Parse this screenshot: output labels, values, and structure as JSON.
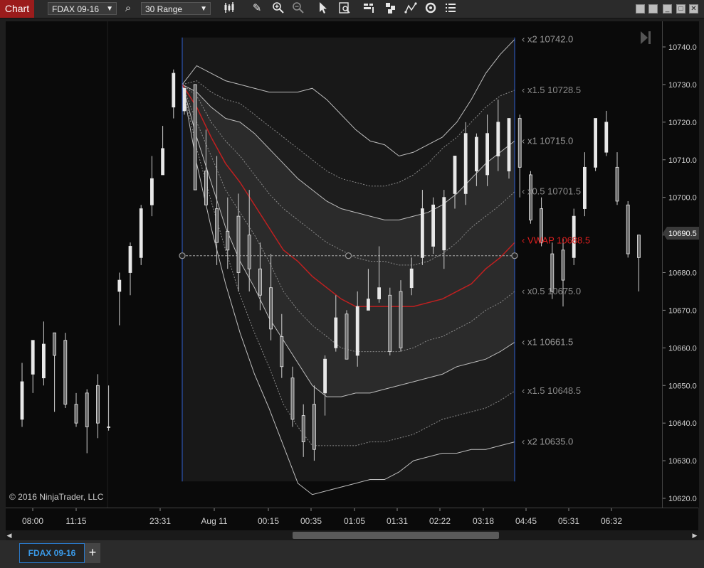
{
  "toolbar": {
    "title": "Chart",
    "instrument": "FDAX 09-16",
    "interval": "30 Range",
    "icons": [
      "search-icon",
      "bar-type-icon",
      "pencil-icon",
      "zoom-in-icon",
      "zoom-out-icon",
      "pointer-icon",
      "data-box-icon",
      "strategies-icon",
      "indicators-icon",
      "properties-icon",
      "reload-icon",
      "list-icon"
    ],
    "window_buttons": [
      "tile-icon",
      "tile-icon",
      "minimize-icon",
      "maximize-icon",
      "close-icon"
    ]
  },
  "chart": {
    "copyright": "© 2016 NinjaTrader, LLC",
    "last_price": "10690.5",
    "y_ticks": [
      "10740.0",
      "10730.0",
      "10720.0",
      "10710.0",
      "10700.0",
      "10690.0",
      "10680.0",
      "10670.0",
      "10660.0",
      "10650.0",
      "10640.0",
      "10630.0",
      "10620.0"
    ],
    "x_ticks": [
      "08:00",
      "11:15",
      "23:31",
      "Aug 11",
      "00:15",
      "00:35",
      "01:05",
      "01:31",
      "02:22",
      "03:18",
      "04:45",
      "05:31",
      "06:32"
    ],
    "vwap_labels": [
      {
        "text": "x2 10742.0",
        "color": "#9a9a9a"
      },
      {
        "text": "x1.5 10728.5",
        "color": "#8a8a8a"
      },
      {
        "text": "x1 10715.0",
        "color": "#9a9a9a"
      },
      {
        "text": "x0.5 10701.5",
        "color": "#8a8a8a"
      },
      {
        "text": "VWAP 10688.5",
        "color": "#e01e1e"
      },
      {
        "text": "x0.5 10675.0",
        "color": "#8a8a8a"
      },
      {
        "text": "x1 10661.5",
        "color": "#9a9a9a"
      },
      {
        "text": "x1.5 10648.5",
        "color": "#8a8a8a"
      },
      {
        "text": "x2 10635.0",
        "color": "#9a9a9a"
      }
    ]
  },
  "chart_data": {
    "type": "candlestick",
    "ylim": [
      10616,
      10748
    ],
    "candles": [
      {
        "o": 10641,
        "c": 10651,
        "h": 10656,
        "l": 10639
      },
      {
        "o": 10653,
        "c": 10662,
        "h": 10662,
        "l": 10648
      },
      {
        "o": 10652,
        "c": 10661,
        "h": 10667,
        "l": 10650
      },
      {
        "o": 10664,
        "c": 10658,
        "h": 10664,
        "l": 10643
      },
      {
        "o": 10662,
        "c": 10645,
        "h": 10664,
        "l": 10644
      },
      {
        "o": 10645,
        "c": 10640,
        "h": 10648,
        "l": 10639
      },
      {
        "o": 10648,
        "c": 10639,
        "h": 10649,
        "l": 10632
      },
      {
        "o": 10650,
        "c": 10640,
        "h": 10653,
        "l": 10636
      },
      {
        "o": 10639,
        "c": 10639,
        "h": 10650,
        "l": 10638
      },
      {
        "o": 10675,
        "c": 10678,
        "h": 10680,
        "l": 10666
      },
      {
        "o": 10680,
        "c": 10687,
        "h": 10688,
        "l": 10674
      },
      {
        "o": 10684,
        "c": 10697,
        "h": 10698,
        "l": 10682
      },
      {
        "o": 10698,
        "c": 10705,
        "h": 10711,
        "l": 10695
      },
      {
        "o": 10706,
        "c": 10713,
        "h": 10719,
        "l": 10706
      },
      {
        "o": 10724,
        "c": 10733,
        "h": 10734,
        "l": 10721
      },
      {
        "o": 10723,
        "c": 10729,
        "h": 10729,
        "l": 10722
      },
      {
        "o": 10730,
        "c": 10702,
        "h": 10730,
        "l": 10703
      },
      {
        "o": 10707,
        "c": 10698,
        "h": 10718,
        "l": 10698
      },
      {
        "o": 10697,
        "c": 10688,
        "h": 10711,
        "l": 10682
      },
      {
        "o": 10691,
        "c": 10686,
        "h": 10700,
        "l": 10681
      },
      {
        "o": 10695,
        "c": 10680,
        "h": 10701,
        "l": 10675
      },
      {
        "o": 10690,
        "c": 10681,
        "h": 10702,
        "l": 10675
      },
      {
        "o": 10681,
        "c": 10674,
        "h": 10688,
        "l": 10670
      },
      {
        "o": 10676,
        "c": 10665,
        "h": 10685,
        "l": 10662
      },
      {
        "o": 10663,
        "c": 10655,
        "h": 10669,
        "l": 10652
      },
      {
        "o": 10652,
        "c": 10641,
        "h": 10655,
        "l": 10639
      },
      {
        "o": 10642,
        "c": 10635,
        "h": 10645,
        "l": 10631
      },
      {
        "o": 10645,
        "c": 10633,
        "h": 10650,
        "l": 10630
      },
      {
        "o": 10648,
        "c": 10657,
        "h": 10658,
        "l": 10642
      },
      {
        "o": 10660,
        "c": 10668,
        "h": 10674,
        "l": 10659
      },
      {
        "o": 10669,
        "c": 10657,
        "h": 10670,
        "l": 10657
      },
      {
        "o": 10658,
        "c": 10671,
        "h": 10675,
        "l": 10655
      },
      {
        "o": 10670,
        "c": 10673,
        "h": 10681,
        "l": 10670
      },
      {
        "o": 10673,
        "c": 10676,
        "h": 10687,
        "l": 10672
      },
      {
        "o": 10674,
        "c": 10659,
        "h": 10676,
        "l": 10658
      },
      {
        "o": 10675,
        "c": 10660,
        "h": 10678,
        "l": 10659
      },
      {
        "o": 10676,
        "c": 10681,
        "h": 10684,
        "l": 10674
      },
      {
        "o": 10684,
        "c": 10697,
        "h": 10702,
        "l": 10682
      },
      {
        "o": 10687,
        "c": 10698,
        "h": 10700,
        "l": 10685
      },
      {
        "o": 10686,
        "c": 10700,
        "h": 10702,
        "l": 10681
      },
      {
        "o": 10701,
        "c": 10711,
        "h": 10711,
        "l": 10697
      },
      {
        "o": 10701,
        "c": 10717,
        "h": 10720,
        "l": 10698
      },
      {
        "o": 10707,
        "c": 10716,
        "h": 10717,
        "l": 10703
      },
      {
        "o": 10706,
        "c": 10717,
        "h": 10722,
        "l": 10703
      },
      {
        "o": 10711,
        "c": 10720,
        "h": 10726,
        "l": 10707
      },
      {
        "o": 10707,
        "c": 10721,
        "h": 10721,
        "l": 10705
      },
      {
        "o": 10721,
        "c": 10708,
        "h": 10722,
        "l": 10700
      },
      {
        "o": 10706,
        "c": 10694,
        "h": 10707,
        "l": 10693
      },
      {
        "o": 10697,
        "c": 10688,
        "h": 10700,
        "l": 10687
      },
      {
        "o": 10685,
        "c": 10675,
        "h": 10688,
        "l": 10673
      },
      {
        "o": 10686,
        "c": 10678,
        "h": 10689,
        "l": 10671
      },
      {
        "o": 10684,
        "c": 10695,
        "h": 10697,
        "l": 10682
      },
      {
        "o": 10697,
        "c": 10708,
        "h": 10712,
        "l": 10695
      },
      {
        "o": 10708,
        "c": 10721,
        "h": 10721,
        "l": 10707
      },
      {
        "o": 10712,
        "c": 10720,
        "h": 10723,
        "l": 10711
      },
      {
        "o": 10708,
        "c": 10699,
        "h": 10712,
        "l": 10698
      },
      {
        "o": 10698,
        "c": 10685,
        "h": 10699,
        "l": 10684
      },
      {
        "o": 10690,
        "c": 10684,
        "h": 10690,
        "l": 10675
      }
    ],
    "vwap": [
      10730,
      10724,
      10716,
      10709,
      10704,
      10698,
      10692,
      10686,
      10683,
      10679,
      10676,
      10673,
      10671,
      10671,
      10671,
      10671,
      10671,
      10672,
      10673,
      10675,
      10677,
      10681,
      10684,
      10688
    ],
    "bands": [
      {
        "mult": 0.5,
        "upper": [
          10730,
          10727,
          10720,
          10715,
          10711,
          10706,
          10701,
          10697,
          10694,
          10691,
          10688,
          10686,
          10684,
          10683,
          10683,
          10682,
          10682,
          10683,
          10685,
          10688,
          10692,
          10695,
          10698,
          10701.5
        ],
        "lower": [
          10730,
          10720,
          10711,
          10702,
          10696,
          10690,
          10683,
          10675,
          10670,
          10666,
          10663,
          10660,
          10659,
          10659,
          10659,
          10659,
          10660,
          10662,
          10663,
          10665,
          10667,
          10670,
          10672,
          10675
        ]
      },
      {
        "mult": 1,
        "upper": [
          10730,
          10728,
          10724,
          10721,
          10720,
          10717,
          10713,
          10709,
          10705,
          10702,
          10699,
          10697,
          10696,
          10695,
          10694,
          10694,
          10695,
          10696,
          10698,
          10701,
          10705,
          10709,
          10712,
          10715
        ],
        "lower": [
          10730,
          10716,
          10704,
          10692,
          10683,
          10676,
          10668,
          10662,
          10656,
          10650,
          10647,
          10647,
          10648,
          10648,
          10649,
          10650,
          10651,
          10652,
          10653,
          10655,
          10656,
          10657,
          10659,
          10661.5
        ]
      },
      {
        "mult": 1.5,
        "upper": [
          10730,
          10731,
          10728,
          10726,
          10725,
          10722,
          10719,
          10716,
          10713,
          10710,
          10707,
          10705,
          10704,
          10703,
          10703,
          10704,
          10706,
          10709,
          10713,
          10716,
          10720,
          10724,
          10727,
          10728.5
        ],
        "lower": [
          10730,
          10713,
          10699,
          10686,
          10674,
          10664,
          10655,
          10645,
          10639,
          10634,
          10634,
          10634,
          10634,
          10635,
          10635,
          10636,
          10637,
          10639,
          10641,
          10642,
          10643,
          10644,
          10646,
          10648.5
        ]
      },
      {
        "mult": 2,
        "upper": [
          10730,
          10735,
          10733,
          10731,
          10730,
          10729,
          10728,
          10728,
          10728,
          10729,
          10726,
          10722,
          10718,
          10715,
          10714,
          10711,
          10712,
          10714,
          10716,
          10720,
          10726,
          10733,
          10738,
          10742
        ],
        "lower": [
          10730,
          10709,
          10692,
          10677,
          10664,
          10653,
          10644,
          10634,
          10624,
          10621,
          10622,
          10623,
          10624,
          10625,
          10625,
          10627,
          10630,
          10631,
          10632,
          10632,
          10633,
          10633,
          10634,
          10635
        ]
      }
    ],
    "horizontal_line": 10684.5
  }
}
